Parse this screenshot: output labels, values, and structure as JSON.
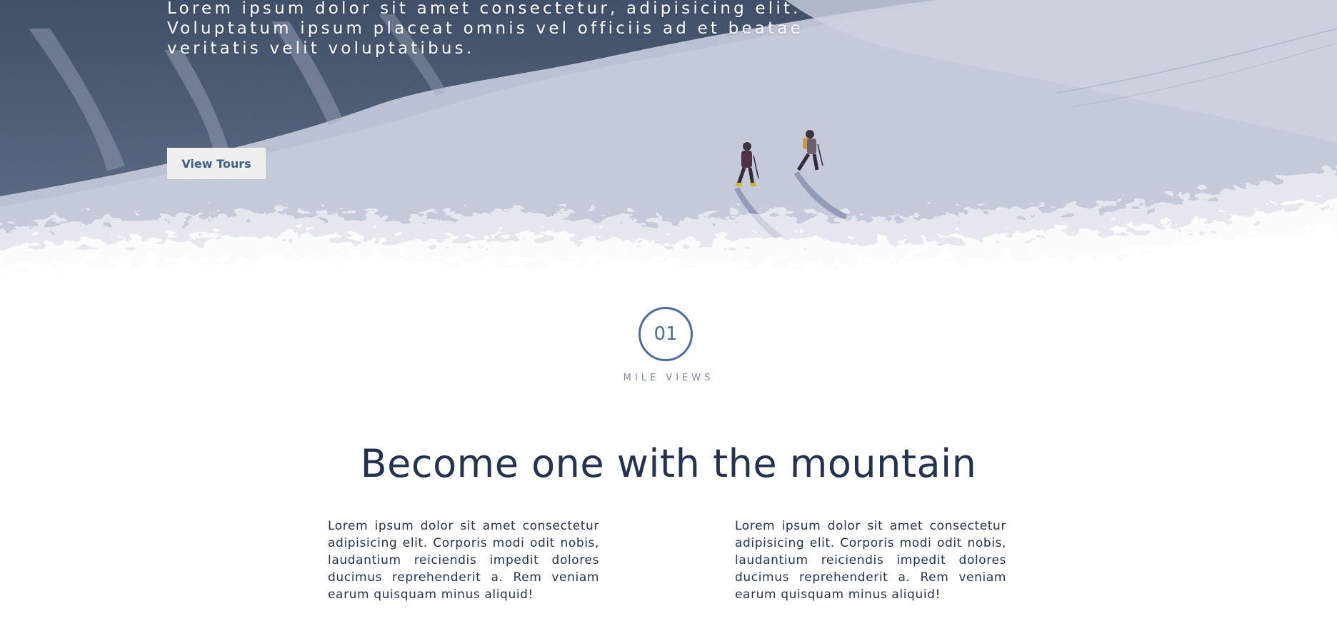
{
  "hero": {
    "lines": [
      "Lorem ipsum dolor sit amet consectetur, adipisicing elit.",
      "Voluptatum ipsum placeat omnis vel officiis ad et beatae",
      "veritatis velit voluptatibus."
    ],
    "cta_label": "View Tours"
  },
  "feature": {
    "number": "01",
    "label": "MILE VIEWS"
  },
  "section": {
    "heading": "Become one with the mountain",
    "columns": [
      "Lorem ipsum dolor sit amet consectetur adipisicing elit. Corporis modi odit nobis, laudantium reiciendis impedit dolores ducimus reprehenderit a. Rem veniam earum quisquam minus aliquid!",
      "Lorem ipsum dolor sit amet consectetur adipisicing elit. Corporis modi odit nobis, laudantium reiciendis impedit dolores ducimus reprehenderit a. Rem veniam earum quisquam minus aliquid!"
    ]
  },
  "colors": {
    "accent": "#4a6e9a",
    "heading": "#23324e",
    "snow": "#c9cedd",
    "mountain_dark": "#2c3a52"
  },
  "icons": {
    "hero_image": "snowy-mountain-hikers-image"
  }
}
